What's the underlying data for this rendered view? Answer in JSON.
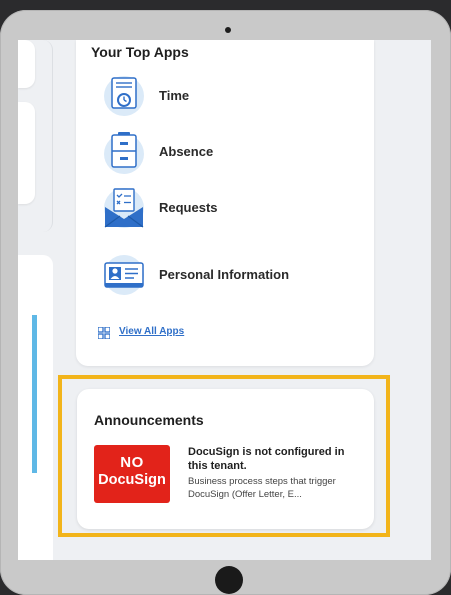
{
  "top_apps": {
    "title": "Your Top Apps",
    "items": [
      {
        "label": "Time",
        "icon": "time-clock-icon"
      },
      {
        "label": "Absence",
        "icon": "absence-cabinet-icon"
      },
      {
        "label": "Requests",
        "icon": "requests-envelope-icon"
      },
      {
        "label": "Personal Information",
        "icon": "personal-info-card-icon"
      }
    ],
    "view_all": "View All Apps"
  },
  "announcements": {
    "title": "Announcements",
    "badge_line1": "NO",
    "badge_line2": "DocuSign",
    "headline": "DocuSign is not configured in this tenant.",
    "body": "Business process steps that trigger DocuSign (Offer Letter, E..."
  },
  "colors": {
    "highlight": "#f2b41a",
    "badge": "#e2231a",
    "link": "#2f6fc8",
    "icon_blue": "#2f6fc8",
    "icon_light": "#dbeaf8"
  }
}
